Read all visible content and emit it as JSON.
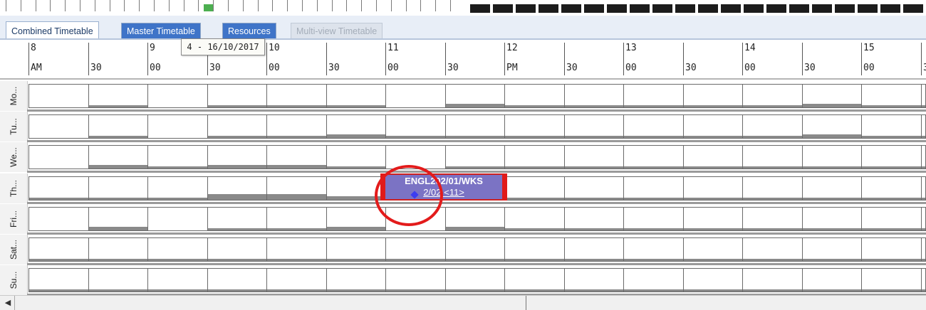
{
  "tabs": [
    {
      "label": "Combined Timetable",
      "state": "active"
    },
    {
      "label": "Master Timetable",
      "state": "blue"
    },
    {
      "label": "Resources",
      "state": "blue"
    },
    {
      "label": "Multi-view Timetable",
      "state": "disabled"
    }
  ],
  "tooltip": "4 - 16/10/2017",
  "timeline": {
    "hours": [
      "8",
      "9",
      "10",
      "11",
      "12",
      "13",
      "14",
      "15"
    ],
    "subs": [
      "AM",
      "30",
      "00",
      "30",
      "00",
      "30",
      "00",
      "30",
      "PM",
      "30",
      "00",
      "30",
      "00",
      "30",
      "00",
      "3"
    ]
  },
  "days": [
    {
      "label": "Mo...",
      "shade": [
        0,
        3,
        0,
        3,
        3,
        3,
        0,
        5,
        3,
        3,
        3,
        3,
        3,
        5,
        3,
        3
      ]
    },
    {
      "label": "Tu...",
      "shade": [
        0,
        3,
        0,
        3,
        3,
        5,
        3,
        3,
        3,
        3,
        3,
        3,
        3,
        5,
        3,
        3
      ]
    },
    {
      "label": "We...",
      "shade": [
        0,
        5,
        3,
        5,
        5,
        3,
        0,
        3,
        3,
        3,
        3,
        3,
        3,
        3,
        3,
        3
      ]
    },
    {
      "label": "Th...",
      "shade": [
        3,
        3,
        3,
        8,
        8,
        5,
        0,
        0,
        3,
        3,
        3,
        3,
        3,
        3,
        3,
        3
      ]
    },
    {
      "label": "Fri...",
      "shade": [
        0,
        5,
        0,
        3,
        3,
        5,
        0,
        5,
        3,
        3,
        3,
        3,
        3,
        3,
        3,
        3
      ]
    },
    {
      "label": "Sat...",
      "shade": [
        3,
        3,
        3,
        3,
        3,
        3,
        3,
        3,
        3,
        3,
        3,
        3,
        3,
        3,
        3,
        3
      ]
    },
    {
      "label": "Su...",
      "shade": [
        3,
        3,
        3,
        3,
        3,
        3,
        3,
        3,
        3,
        3,
        3,
        3,
        3,
        3,
        3,
        3
      ]
    }
  ],
  "event": {
    "line1": "ENGL202/01/WKS",
    "line2": "2/02 <11>",
    "color": "#7b73c4"
  },
  "colors": {
    "annotation": "#e31b1b",
    "tabBlue": "#3f74c8"
  }
}
